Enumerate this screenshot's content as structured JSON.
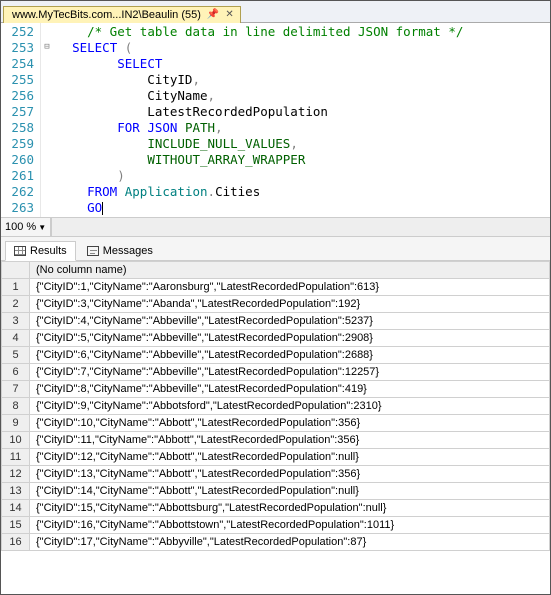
{
  "tab": {
    "label": "www.MyTecBits.com...IN2\\Beaulin (55)"
  },
  "zoom": {
    "value": "100 %"
  },
  "editor": {
    "lines": [
      {
        "num": "252",
        "fold": "",
        "html": "    <span class='comment'>/* Get table data in line delimited JSON format */</span>"
      },
      {
        "num": "253",
        "fold": "⊟",
        "html": "  <span class='kw'>SELECT</span> <span class='op'>(</span>"
      },
      {
        "num": "254",
        "fold": "",
        "html": "        <span class='kw'>SELECT</span>"
      },
      {
        "num": "255",
        "fold": "",
        "html": "            CityID<span class='op'>,</span>"
      },
      {
        "num": "256",
        "fold": "",
        "html": "            CityName<span class='op'>,</span>"
      },
      {
        "num": "257",
        "fold": "",
        "html": "            LatestRecordedPopulation"
      },
      {
        "num": "258",
        "fold": "",
        "html": "        <span class='kw'>FOR</span> <span class='kw'>JSON</span> <span class='func'>PATH</span><span class='op'>,</span>"
      },
      {
        "num": "259",
        "fold": "",
        "html": "            <span class='func'>INCLUDE_NULL_VALUES</span><span class='op'>,</span>"
      },
      {
        "num": "260",
        "fold": "",
        "html": "            <span class='func'>WITHOUT_ARRAY_WRAPPER</span>"
      },
      {
        "num": "261",
        "fold": "",
        "html": "        <span class='op'>)</span>"
      },
      {
        "num": "262",
        "fold": "",
        "html": "    <span class='kw'>FROM</span> <span class='ident'>Application</span><span class='op'>.</span>Cities"
      },
      {
        "num": "263",
        "fold": "",
        "html": "    <span class='kw'>GO</span><span class='caret'></span>"
      }
    ]
  },
  "result_tabs": {
    "results": "Results",
    "messages": "Messages"
  },
  "grid": {
    "header": "(No column name)",
    "rows": [
      "{\"CityID\":1,\"CityName\":\"Aaronsburg\",\"LatestRecordedPopulation\":613}",
      "{\"CityID\":3,\"CityName\":\"Abanda\",\"LatestRecordedPopulation\":192}",
      "{\"CityID\":4,\"CityName\":\"Abbeville\",\"LatestRecordedPopulation\":5237}",
      "{\"CityID\":5,\"CityName\":\"Abbeville\",\"LatestRecordedPopulation\":2908}",
      "{\"CityID\":6,\"CityName\":\"Abbeville\",\"LatestRecordedPopulation\":2688}",
      "{\"CityID\":7,\"CityName\":\"Abbeville\",\"LatestRecordedPopulation\":12257}",
      "{\"CityID\":8,\"CityName\":\"Abbeville\",\"LatestRecordedPopulation\":419}",
      "{\"CityID\":9,\"CityName\":\"Abbotsford\",\"LatestRecordedPopulation\":2310}",
      "{\"CityID\":10,\"CityName\":\"Abbott\",\"LatestRecordedPopulation\":356}",
      "{\"CityID\":11,\"CityName\":\"Abbott\",\"LatestRecordedPopulation\":356}",
      "{\"CityID\":12,\"CityName\":\"Abbott\",\"LatestRecordedPopulation\":null}",
      "{\"CityID\":13,\"CityName\":\"Abbott\",\"LatestRecordedPopulation\":356}",
      "{\"CityID\":14,\"CityName\":\"Abbott\",\"LatestRecordedPopulation\":null}",
      "{\"CityID\":15,\"CityName\":\"Abbottsburg\",\"LatestRecordedPopulation\":null}",
      "{\"CityID\":16,\"CityName\":\"Abbottstown\",\"LatestRecordedPopulation\":1011}",
      "{\"CityID\":17,\"CityName\":\"Abbyville\",\"LatestRecordedPopulation\":87}"
    ]
  }
}
